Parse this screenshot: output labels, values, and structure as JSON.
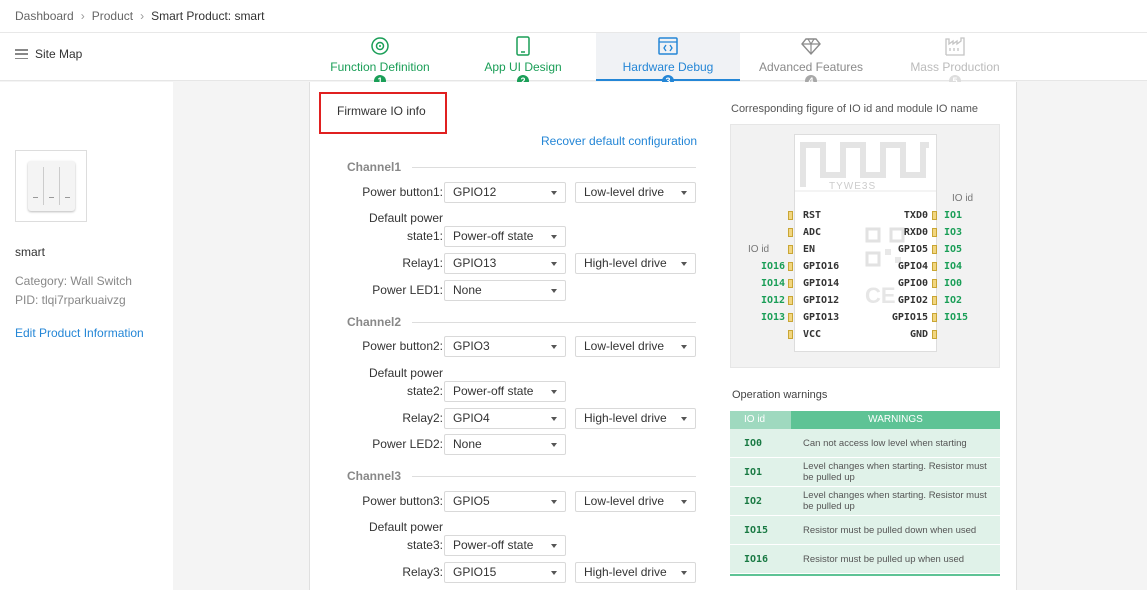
{
  "breadcrumb": {
    "items": [
      "Dashboard",
      "Product",
      "Smart Product: smart"
    ]
  },
  "sitemap": {
    "label": "Site Map"
  },
  "steps": [
    {
      "label": "Function Definition",
      "num": "1",
      "state": "done",
      "icon": "gear-circle-icon"
    },
    {
      "label": "App UI Design",
      "num": "2",
      "state": "done",
      "icon": "phone-icon"
    },
    {
      "label": "Hardware Debug",
      "num": "3",
      "state": "active",
      "icon": "code-window-icon"
    },
    {
      "label": "Advanced Features",
      "num": "4",
      "state": "todo",
      "icon": "diamond-icon"
    },
    {
      "label": "Mass Production",
      "num": "5",
      "state": "dim",
      "icon": "factory-icon"
    }
  ],
  "product": {
    "name": "smart",
    "category": "Category: Wall Switch",
    "pid": "PID: tlqi7rparkuaivzg",
    "edit_link": "Edit Product Information"
  },
  "firmware": {
    "title": "Firmware IO info",
    "recover_link": "Recover default configuration",
    "channels": [
      {
        "title": "Channel1",
        "rows": [
          {
            "label": "Power button1:",
            "value": "GPIO12",
            "drive": "Low-level drive"
          },
          {
            "label_line1": "Default power",
            "label_line2": "state1:",
            "value": "Power-off state"
          },
          {
            "label": "Relay1:",
            "value": "GPIO13",
            "drive": "High-level drive"
          },
          {
            "label": "Power LED1:",
            "value": "None"
          }
        ]
      },
      {
        "title": "Channel2",
        "rows": [
          {
            "label": "Power button2:",
            "value": "GPIO3",
            "drive": "Low-level drive"
          },
          {
            "label_line1": "Default power",
            "label_line2": "state2:",
            "value": "Power-off state"
          },
          {
            "label": "Relay2:",
            "value": "GPIO4",
            "drive": "High-level drive"
          },
          {
            "label": "Power LED2:",
            "value": "None"
          }
        ]
      },
      {
        "title": "Channel3",
        "rows": [
          {
            "label": "Power button3:",
            "value": "GPIO5",
            "drive": "Low-level drive"
          },
          {
            "label_line1": "Default power",
            "label_line2": "state3:",
            "value": "Power-off state"
          },
          {
            "label": "Relay3:",
            "value": "GPIO15",
            "drive": "High-level drive"
          }
        ]
      }
    ]
  },
  "module": {
    "title": "Corresponding figure of IO id and module IO name",
    "chip_name": "TYWE3S",
    "io_id_header": "IO id",
    "left_pins": [
      {
        "pin": "RST",
        "io": ""
      },
      {
        "pin": "ADC",
        "io": ""
      },
      {
        "pin": "EN",
        "io": ""
      },
      {
        "pin": "GPIO16",
        "io": "IO16"
      },
      {
        "pin": "GPIO14",
        "io": "IO14"
      },
      {
        "pin": "GPIO12",
        "io": "IO12"
      },
      {
        "pin": "GPIO13",
        "io": "IO13"
      },
      {
        "pin": "VCC",
        "io": ""
      }
    ],
    "right_pins": [
      {
        "pin": "TXD0",
        "io": "IO1"
      },
      {
        "pin": "RXD0",
        "io": "IO3"
      },
      {
        "pin": "GPIO5",
        "io": "IO5"
      },
      {
        "pin": "GPIO4",
        "io": "IO4"
      },
      {
        "pin": "GPIO0",
        "io": "IO0"
      },
      {
        "pin": "GPIO2",
        "io": "IO2"
      },
      {
        "pin": "GPIO15",
        "io": "IO15"
      },
      {
        "pin": "GND",
        "io": ""
      }
    ]
  },
  "warnings": {
    "title": "Operation warnings",
    "header": {
      "io": "IO id",
      "warning": "WARNINGS"
    },
    "rows": [
      {
        "io": "IO0",
        "text": "Can not access low level when starting"
      },
      {
        "io": "IO1",
        "text": "Level changes when starting. Resistor must be pulled up"
      },
      {
        "io": "IO2",
        "text": "Level changes when starting. Resistor must be pulled up"
      },
      {
        "io": "IO15",
        "text": "Resistor must be pulled down when used"
      },
      {
        "io": "IO16",
        "text": "Resistor must be pulled up when used"
      }
    ]
  },
  "colors": {
    "accent_blue": "#2486d6",
    "accent_green": "#1a9e57",
    "warning_header": "#5ec395",
    "highlight_red": "#e02020"
  }
}
